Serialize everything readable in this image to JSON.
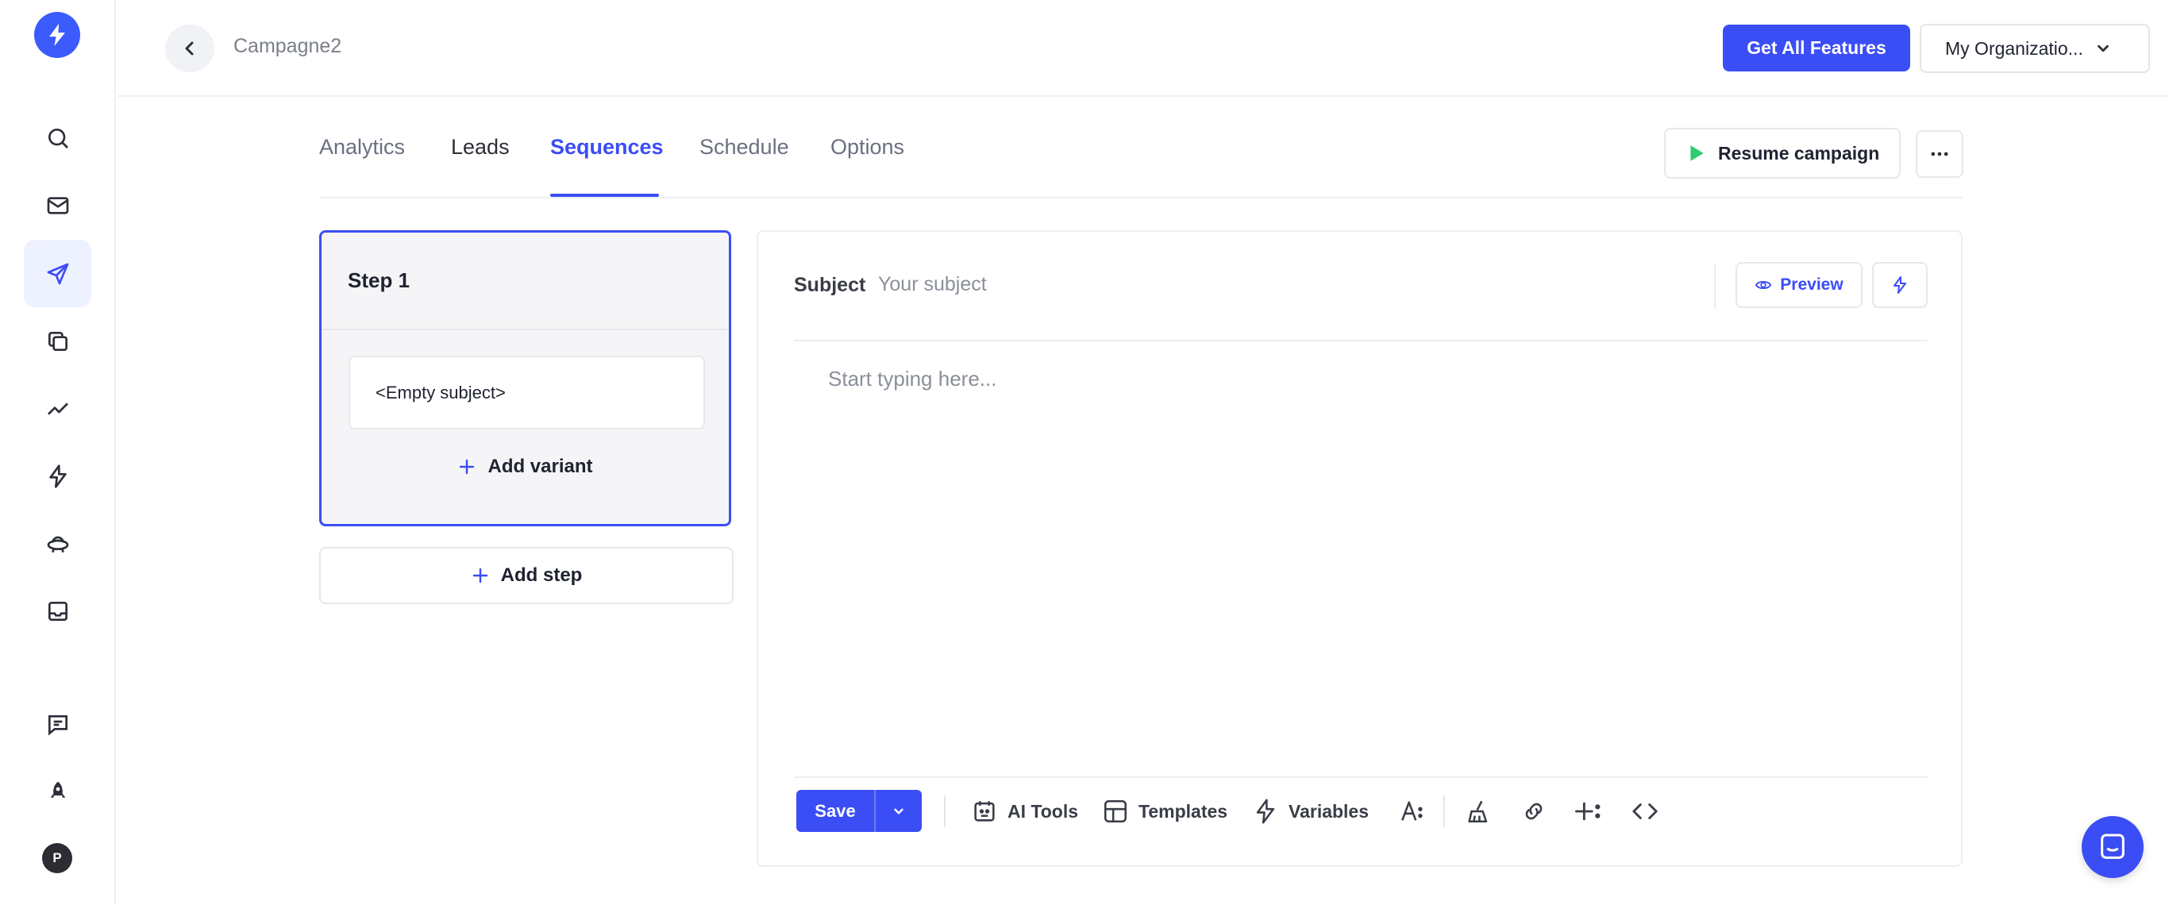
{
  "nav": {
    "items": [
      {
        "icon": "search-icon"
      },
      {
        "icon": "mail-icon"
      },
      {
        "icon": "send-icon",
        "active": true
      },
      {
        "icon": "copy-icon"
      },
      {
        "icon": "analytics-icon"
      },
      {
        "icon": "bolt-icon"
      },
      {
        "icon": "ufo-icon"
      },
      {
        "icon": "inbox-icon"
      },
      {
        "icon": "feedback-icon"
      },
      {
        "icon": "rocket-icon"
      }
    ],
    "avatar_initial": "P"
  },
  "header": {
    "breadcrumb": "Campagne2",
    "cta_label": "Get All Features",
    "org_label": "My Organizatio..."
  },
  "tabs": [
    {
      "label": "Analytics"
    },
    {
      "label": "Leads"
    },
    {
      "label": "Sequences",
      "active": true
    },
    {
      "label": "Schedule"
    },
    {
      "label": "Options"
    }
  ],
  "actions": {
    "resume_label": "Resume campaign"
  },
  "sequence": {
    "step_title": "Step 1",
    "variant_subject": "<Empty subject>",
    "add_variant_label": "Add variant",
    "add_step_label": "Add step"
  },
  "editor": {
    "subject_label": "Subject",
    "subject_placeholder": "Your subject",
    "subject_value": "",
    "preview_label": "Preview",
    "body_placeholder": "Start typing here...",
    "save_label": "Save",
    "tools": [
      {
        "label": "AI Tools",
        "icon": "ai-tools-icon"
      },
      {
        "label": "Templates",
        "icon": "templates-icon"
      },
      {
        "label": "Variables",
        "icon": "variables-icon"
      }
    ]
  },
  "colors": {
    "accent": "#3b4df5",
    "resume_play": "#2ecc71"
  }
}
